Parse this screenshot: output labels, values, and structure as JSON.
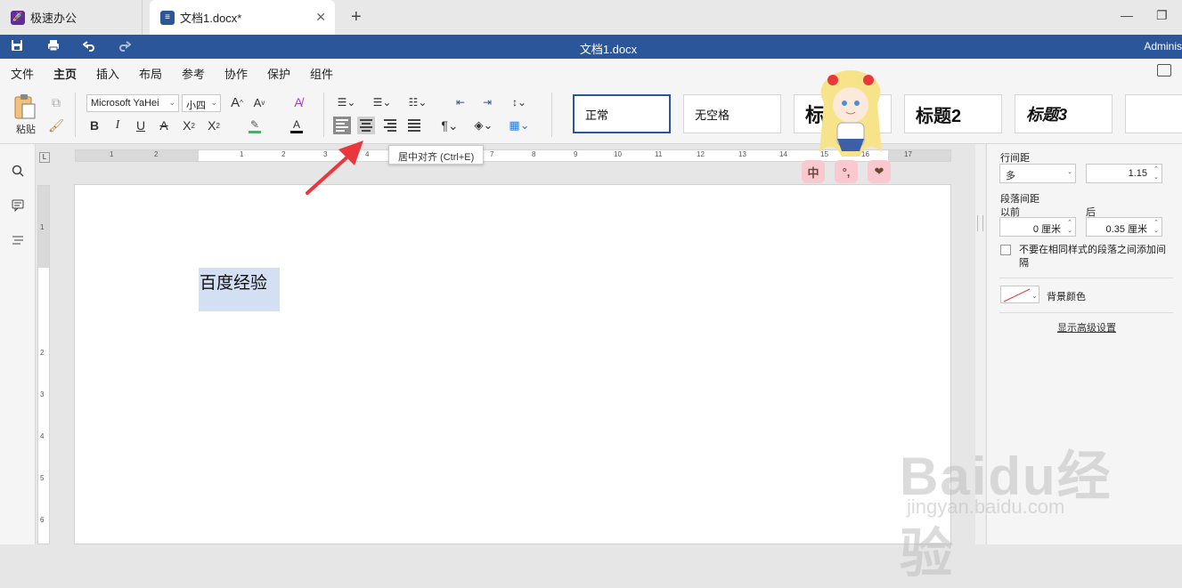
{
  "tabs": {
    "home_label": "极速办公",
    "doc_label": "文档1.docx*"
  },
  "titlebar": {
    "doc_title": "文档1.docx",
    "user": "Adminis"
  },
  "menu": [
    "文件",
    "主页",
    "插入",
    "布局",
    "参考",
    "协作",
    "保护",
    "组件"
  ],
  "ribbon": {
    "paste_label": "粘贴",
    "font_name": "Microsoft YaHei",
    "font_size": "小四",
    "styles": [
      "正常",
      "无空格",
      "标题1",
      "标题2",
      "标题3"
    ]
  },
  "tooltip": "居中对齐 (Ctrl+E)",
  "ruler_h": [
    "1",
    "2",
    "1",
    "1",
    "2",
    "3",
    "4",
    "5",
    "6",
    "7",
    "8",
    "9",
    "10",
    "11",
    "12",
    "13",
    "14",
    "15",
    "16",
    "17"
  ],
  "ruler_v": [
    "1",
    "2",
    "3",
    "4",
    "5",
    "6"
  ],
  "document": {
    "selected_text": "百度经验"
  },
  "panel": {
    "line_spacing_label": "行间距",
    "line_spacing_mode": "多",
    "line_spacing_value": "1.15",
    "para_spacing_label": "段落间距",
    "before_label": "以前",
    "after_label": "后",
    "before_value": "0 厘米",
    "after_value": "0.35 厘米",
    "no_space_same_style": "不要在相同样式的段落之间添加间隔",
    "bg_color_label": "背景颜色",
    "advanced_link": "显示高级设置"
  },
  "stickers": [
    "中",
    "°,",
    "❤"
  ],
  "watermark": {
    "brand": "Baidu经验",
    "url": "jingyan.baidu.com"
  },
  "colors": {
    "title_blue": "#2b579a",
    "highlight": "#d3dff3",
    "arrow_red": "#e8383d",
    "highlighter_green": "#22c55e",
    "sticker_pink": "#f9c9cf"
  }
}
